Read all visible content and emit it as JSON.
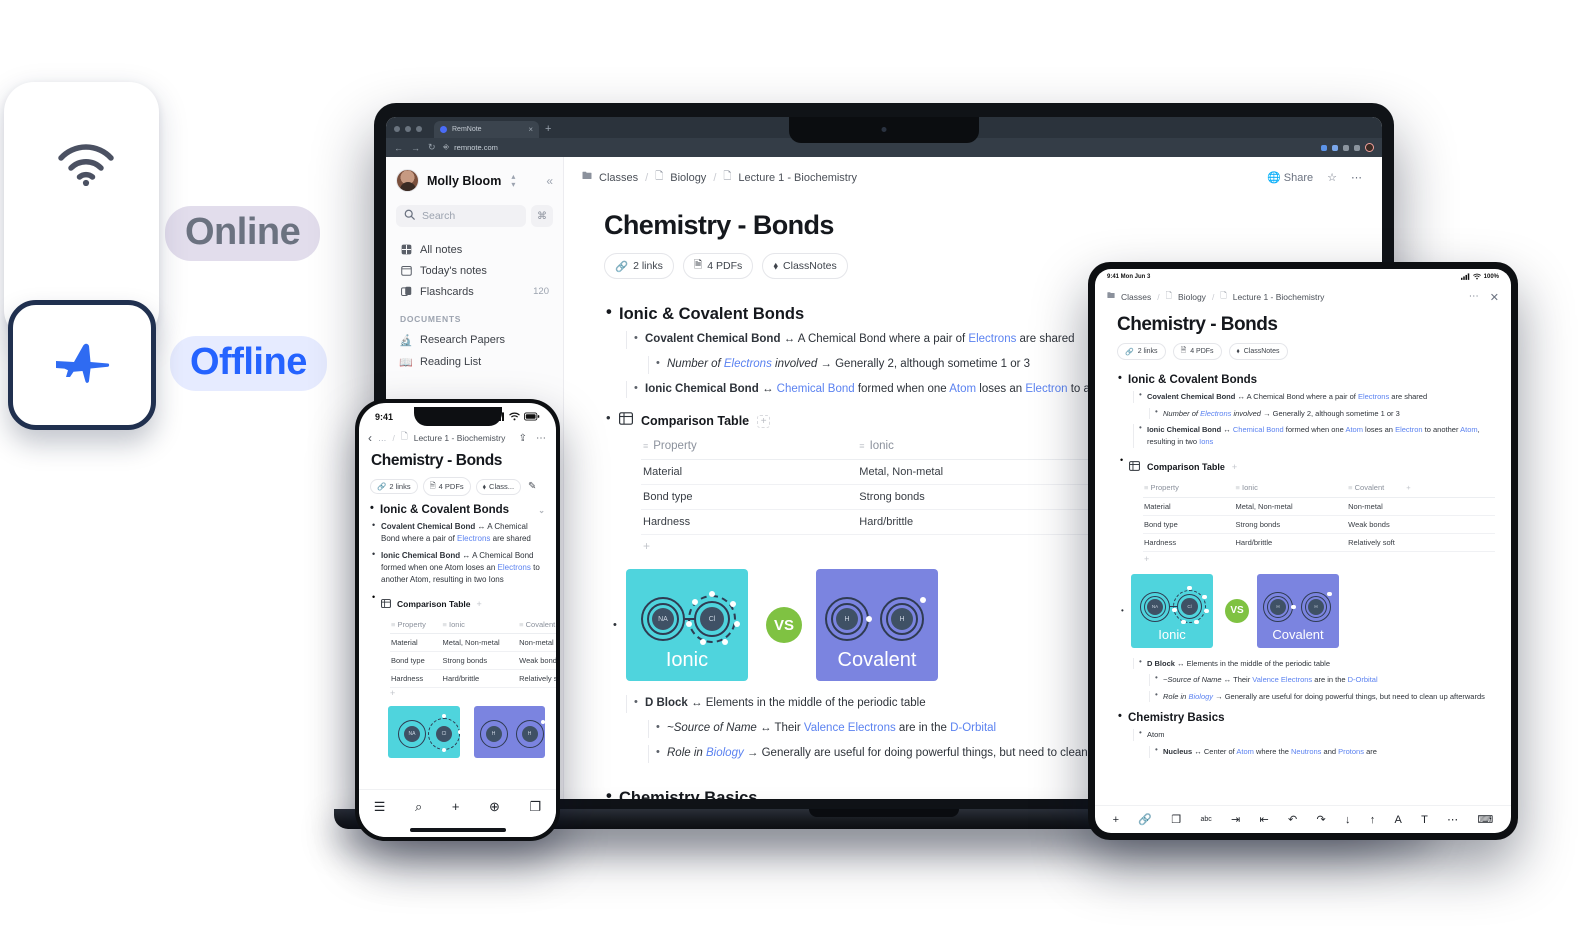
{
  "toggle_widget": {
    "wifi_icon": "wifi-icon",
    "airplane_icon": "airplane-mode-icon",
    "online_label": "Online",
    "offline_label": "Offline",
    "online_color": "#6b7280",
    "offline_color": "#2563ff"
  },
  "browser": {
    "tab_title": "RemNote",
    "tab_close": "×",
    "new_tab": "+",
    "back": "←",
    "forward": "→",
    "reload": "↻",
    "url": "remnote.com",
    "lock_icon": "shield-icon"
  },
  "sidebar": {
    "user_name": "Molly Bloom",
    "collapse_icon": "«",
    "search_placeholder": "Search",
    "search_shortcut": "⌘",
    "items": [
      {
        "label": "All notes",
        "icon": "⊞",
        "count": ""
      },
      {
        "label": "Today's notes",
        "icon": "▢",
        "count": ""
      },
      {
        "label": "Flashcards",
        "icon": "❐",
        "count": "120"
      }
    ],
    "documents_header": "DOCUMENTS",
    "documents": [
      {
        "label": "Research Papers",
        "icon": "🔬"
      },
      {
        "label": "Reading List",
        "icon": "📖"
      }
    ]
  },
  "doc": {
    "breadcrumbs": [
      "Classes",
      "Biology",
      "Lecture 1 - Biochemistry"
    ],
    "separator": "/",
    "share_label": "Share",
    "star_icon": "☆",
    "more_icon": "⋯",
    "title": "Chemistry -  Bonds",
    "chips": [
      {
        "label": "2 links",
        "icon": "link-icon"
      },
      {
        "label": "4 PDFs",
        "icon": "pdf-icon"
      },
      {
        "label": "ClassNotes",
        "icon": "tag-icon"
      }
    ],
    "section1": "Ionic & Covalent Bonds",
    "bullets": {
      "covalent_term": "Covalent Chemical Bond",
      "covalent_rest_a": " ↔ A Chemical Bond where a pair of ",
      "covalent_link": "Electrons",
      "covalent_rest_b": " are shared",
      "number_italic": "Number of ",
      "number_link": "Electrons",
      "number_italic2": " involved",
      "number_rest": " → Generally 2, although sometime 1 or 3",
      "ionic_term": "Ionic Chemical Bond",
      "ionic_arrow": " ↔ ",
      "ionic_link1": "Chemical Bond",
      "ionic_mid1": " formed when one ",
      "ionic_link2": "Atom",
      "ionic_mid2": " loses an ",
      "ionic_link3": "Electron",
      "ionic_mid3": " to another ",
      "ionic_link4": "Atom",
      "ionic_mid4": ", resulting in two ",
      "ionic_link5": "Ions"
    },
    "table": {
      "label": "Comparison Table",
      "add_icon": "+",
      "headers": [
        "Property",
        "Ionic",
        "Covalent"
      ],
      "rows": [
        [
          "Material",
          "Metal, Non-metal",
          "Non-metal"
        ],
        [
          "Bond type",
          "Strong bonds",
          "Weak bonds"
        ],
        [
          "Hardness",
          "Hard/brittle",
          "Relatively soft"
        ]
      ],
      "add_row": "+",
      "add_col": "+"
    },
    "diagram": {
      "ionic_caption": "Ionic",
      "covalent_caption": "Covalent",
      "vs": "VS",
      "ionic_atom_a": "NA",
      "ionic_atom_b": "Cl",
      "covalent_atom_a": "H",
      "covalent_atom_b": "H",
      "ionic_color": "#4fd4dd",
      "covalent_color": "#7b84e0",
      "vs_color": "#7fc242"
    },
    "dblock": {
      "term": "D Block",
      "rest": " ↔ Elements in the middle of the periodic table",
      "source_italic": "~Source of Name",
      "source_mid": " ↔ Their ",
      "source_link1": "Valence Electrons",
      "source_mid2": " are in the ",
      "source_link2": "D-Orbital",
      "role_italic": "Role in ",
      "role_link": "Biology",
      "role_rest": " → Generally are useful for doing powerful things, but need to clean up afterwards"
    },
    "section2": "Chemistry Basics",
    "atom_label": "Atom",
    "nucleus_term": "Nucleus",
    "nucleus_mid1": " ↔ Center of ",
    "nucleus_link1": "Atom",
    "nucleus_mid2": " where the ",
    "nucleus_link2": "Neutrons",
    "nucleus_mid3": " and ",
    "nucleus_link3": "Protons",
    "nucleus_end": " are"
  },
  "phone": {
    "time": "9:41",
    "back_icon": "‹",
    "crumb_ellipsis": "…",
    "crumb_sep": "/",
    "crumb_doc": "Lecture 1 - Biochemistry",
    "share_icon": "share-icon",
    "more_icon": "⋯",
    "title": "Chemistry -  Bonds",
    "chips": [
      {
        "label": "2 links"
      },
      {
        "label": "4 PDFs"
      },
      {
        "label": "Class..."
      }
    ],
    "pen_icon": "pencil-icon",
    "section1": "Ionic & Covalent Bonds",
    "collapse_icon": "⌄",
    "bullet1_bold": "Covalent Chemical Bond",
    "bullet1_a": " ↔ A Chemical Bond where a pair of ",
    "bullet1_link": "Electrons",
    "bullet1_b": " are shared",
    "bullet2_bold": "Ionic Chemical Bond",
    "bullet2_a": " ↔ A Chemical Bond formed when one Atom loses an ",
    "bullet2_link": "Electrons",
    "bullet2_b": " to another Atom, resulting in two Ions",
    "table_label": "Comparison Table",
    "table_add": "+",
    "headers": [
      "Property",
      "Ionic",
      "Covalent"
    ],
    "rows": [
      [
        "Material",
        "Metal, Non-metal",
        "Non-metal"
      ],
      [
        "Bond type",
        "Strong bonds",
        "Weak bonds"
      ],
      [
        "Hardness",
        "Hard/brittle",
        "Relatively soft"
      ]
    ],
    "toolbar": [
      {
        "icon": "☰",
        "name": "menu-icon"
      },
      {
        "icon": "⌕",
        "name": "search-icon"
      },
      {
        "icon": "+",
        "name": "add-icon"
      },
      {
        "icon": "⊕",
        "name": "globe-icon"
      },
      {
        "icon": "❐",
        "name": "flashcards-icon"
      }
    ]
  },
  "tablet": {
    "time": "9:41 Mon Jun 3",
    "battery": "100%",
    "breadcrumbs": [
      "Classes",
      "Biology",
      "Lecture 1 - Biochemistry"
    ],
    "separator": "/",
    "more_icon": "⋯",
    "close_icon": "✕",
    "title": "Chemistry -  Bonds",
    "chips": [
      {
        "label": "2 links"
      },
      {
        "label": "4 PDFs"
      },
      {
        "label": "ClassNotes"
      }
    ],
    "section1": "Ionic & Covalent Bonds",
    "table_label": "Comparison Table",
    "table_add": "+",
    "headers": [
      "Property",
      "Ionic",
      "Covalent"
    ],
    "rows": [
      [
        "Material",
        "Metal, Non-metal",
        "Non-metal"
      ],
      [
        "Bond type",
        "Strong bonds",
        "Weak bonds"
      ],
      [
        "Hardness",
        "Hard/brittle",
        "Relatively soft"
      ]
    ],
    "section2": "Chemistry Basics",
    "atom_label": "Atom",
    "toolbar": [
      {
        "icon": "+",
        "name": "add-icon"
      },
      {
        "icon": "🔗",
        "name": "link-icon"
      },
      {
        "icon": "❐",
        "name": "flashcard-icon"
      },
      {
        "icon": "abc",
        "name": "spellcheck-icon"
      },
      {
        "icon": "⇥",
        "name": "indent-icon"
      },
      {
        "icon": "⇤",
        "name": "outdent-icon"
      },
      {
        "icon": "↶",
        "name": "undo-icon"
      },
      {
        "icon": "↷",
        "name": "redo-icon"
      },
      {
        "icon": "↓",
        "name": "move-down-icon"
      },
      {
        "icon": "↑",
        "name": "move-up-icon"
      },
      {
        "icon": "A",
        "name": "text-color-icon"
      },
      {
        "icon": "T",
        "name": "font-icon"
      },
      {
        "icon": "⋯",
        "name": "more-icon"
      },
      {
        "icon": "⌨",
        "name": "keyboard-icon"
      }
    ]
  }
}
